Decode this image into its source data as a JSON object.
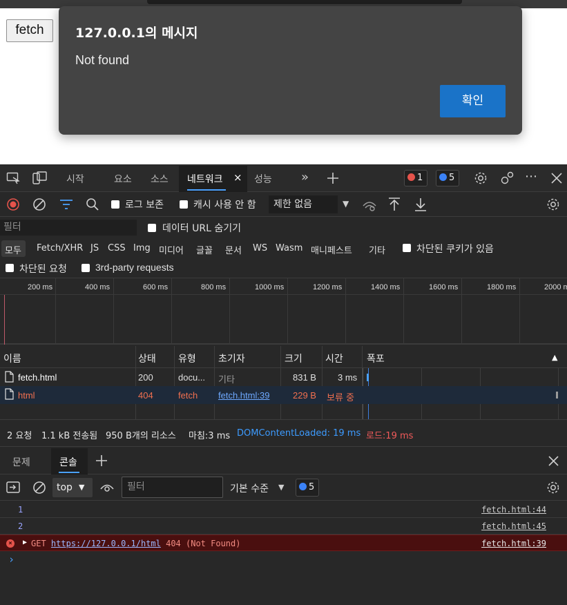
{
  "page": {
    "fetch_button": "fetch"
  },
  "dialog": {
    "title": "127.0.0.1의 메시지",
    "message": "Not found",
    "ok_label": "확인"
  },
  "devtools": {
    "tabs": [
      {
        "label": "시작"
      },
      {
        "label": "요소"
      },
      {
        "label": "소스"
      },
      {
        "label": "네트워크",
        "active": true
      },
      {
        "label": "성능"
      }
    ],
    "close_tab_glyph": "×",
    "error_count": "1",
    "message_count": "5",
    "toolbar": {
      "preserve_log": "로그 보존",
      "disable_cache": "캐시 사용 안 함",
      "throttling": "제한 없음"
    },
    "filter": {
      "placeholder": "필터",
      "hide_data_urls": "데이터 URL 숨기기"
    },
    "type_filters": [
      "모두",
      "Fetch/XHR",
      "JS",
      "CSS",
      "Img",
      "미디어",
      "글꼴",
      "문서",
      "WS",
      "Wasm",
      "매니페스트",
      "기타"
    ],
    "blocked_cookies": "차단된 쿠키가 있음",
    "blocked_requests": "차단된 요청",
    "third_party": "3rd-party requests",
    "overview_ticks": [
      "200 ms",
      "400 ms",
      "600 ms",
      "800 ms",
      "1000 ms",
      "1200 ms",
      "1400 ms",
      "1600 ms",
      "1800 ms",
      "2000 ms"
    ],
    "table": {
      "headers": {
        "name": "이름",
        "status": "상태",
        "type": "유형",
        "initiator": "초기자",
        "size": "크기",
        "time": "시간",
        "waterfall": "폭포"
      },
      "rows": [
        {
          "name": "fetch.html",
          "status": "200",
          "type": "docu...",
          "initiator": "기타",
          "size": "831 B",
          "time": "3 ms",
          "error": false
        },
        {
          "name": "html",
          "status": "404",
          "type": "fetch",
          "initiator": "fetch.html:39",
          "size": "229 B",
          "time": "보류 중",
          "error": true
        }
      ]
    },
    "summary": {
      "requests": "2 요청",
      "transferred": "1.1 kB 전송됨",
      "resources": "950 B개의 리소스",
      "finish": "마침:3 ms",
      "dom_content_loaded": "DOMContentLoaded: 19 ms",
      "load": "로드:19 ms"
    },
    "drawer_tabs": [
      {
        "label": "문제"
      },
      {
        "label": "콘솔",
        "active": true
      }
    ],
    "console_toolbar": {
      "context": "top",
      "filter_placeholder": "필터",
      "level": "기본 수준",
      "message_count": "5"
    },
    "console_lines": [
      {
        "text": "1",
        "source": "fetch.html:44"
      },
      {
        "text": "2",
        "source": "fetch.html:45"
      }
    ],
    "console_error": {
      "method": "GET",
      "url": "https://127.0.0.1/html",
      "status": "404 (Not Found)",
      "source": "fetch.html:39"
    },
    "prompt": "›"
  },
  "colors": {
    "accent": "#4aa1ff",
    "error": "#f2704f",
    "dialog_ok": "#1a73c8",
    "dom_content_loaded": "#3d9bff",
    "load": "#f05a5a"
  }
}
